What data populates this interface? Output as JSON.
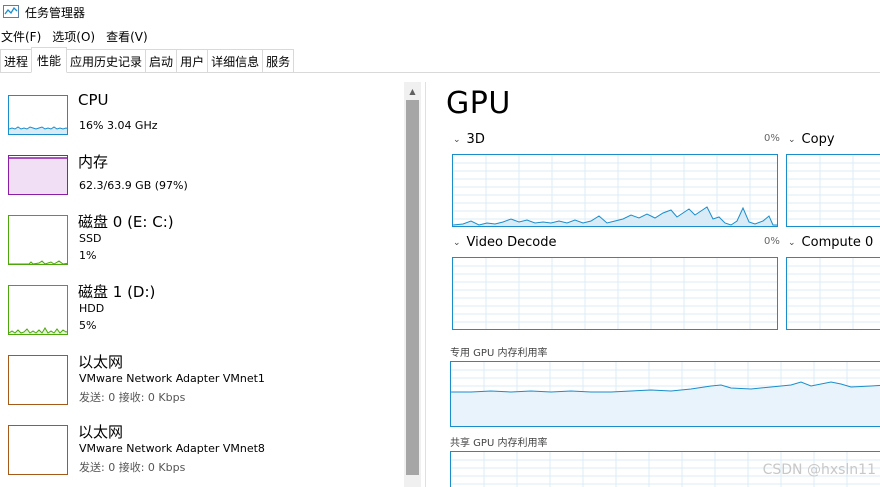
{
  "window": {
    "title": "任务管理器"
  },
  "menu": [
    {
      "label": "文件(F)"
    },
    {
      "label": "选项(O)"
    },
    {
      "label": "查看(V)"
    }
  ],
  "tabs": [
    {
      "label": "进程",
      "active": false
    },
    {
      "label": "性能",
      "active": true
    },
    {
      "label": "应用历史记录",
      "active": false
    },
    {
      "label": "启动",
      "active": false
    },
    {
      "label": "用户",
      "active": false
    },
    {
      "label": "详细信息",
      "active": false
    },
    {
      "label": "服务",
      "active": false
    }
  ],
  "resources": {
    "cpu": {
      "name": "CPU",
      "line1": "16% 3.04 GHz",
      "color": "#1a8ecc"
    },
    "memory": {
      "name": "内存",
      "line1": "62.3/63.9 GB (97%)",
      "color": "#8b1da8"
    },
    "disk0": {
      "name": "磁盘 0 (E: C:)",
      "line1": "SSD",
      "line2": "1%",
      "color": "#4da60c"
    },
    "disk1": {
      "name": "磁盘 1 (D:)",
      "line1": "HDD",
      "line2": "5%",
      "color": "#4da60c"
    },
    "eth1": {
      "name": "以太网",
      "line1": "VMware Network Adapter VMnet1",
      "line2": "发送: 0 接收: 0 Kbps",
      "color": "#a7591a"
    },
    "eth2": {
      "name": "以太网",
      "line1": "VMware Network Adapter VMnet8",
      "line2": "发送: 0 接收: 0 Kbps",
      "color": "#a7591a"
    }
  },
  "gpu": {
    "title": "GPU",
    "engines": [
      {
        "name": "3D",
        "percent": "0%"
      },
      {
        "name": "Copy"
      },
      {
        "name": "Video Decode",
        "percent": "0%"
      },
      {
        "name": "Compute 0"
      }
    ],
    "dedicated_label": "专用 GPU 内存利用率",
    "shared_label": "共享 GPU 内存利用率",
    "accent": "#1a8ecc"
  },
  "watermark": "CSDN @hxsln11"
}
